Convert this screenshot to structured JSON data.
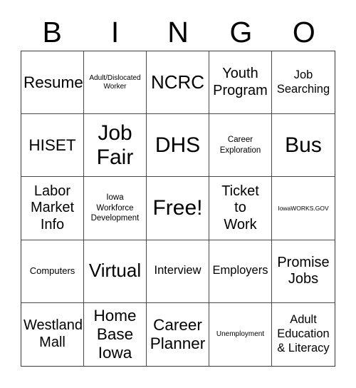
{
  "card": {
    "header_letters": [
      "B",
      "I",
      "N",
      "G",
      "O"
    ],
    "columns": 5,
    "rows": 5,
    "background_color": "#ffffff",
    "text_color": "#000000",
    "border_color": "#3a3a3a",
    "cells": [
      {
        "text": "Resume",
        "size": "fs-l"
      },
      {
        "text": "Adult/Dislocated\nWorker",
        "size": "fs-xs"
      },
      {
        "text": "NCRC",
        "size": "fs-xl"
      },
      {
        "text": "Youth\nProgram",
        "size": "fs-ml"
      },
      {
        "text": "Job\nSearching",
        "size": "fs-m"
      },
      {
        "text": "HISET",
        "size": "fs-l"
      },
      {
        "text": "Job\nFair",
        "size": "fs-xxl"
      },
      {
        "text": "DHS",
        "size": "fs-xxl"
      },
      {
        "text": "Career\nExploration",
        "size": "fs-s"
      },
      {
        "text": "Bus",
        "size": "fs-xxl"
      },
      {
        "text": "Labor\nMarket\nInfo",
        "size": "fs-ml"
      },
      {
        "text": "Iowa\nWorkforce\nDevelopment",
        "size": "fs-s"
      },
      {
        "text": "Free!",
        "size": "fs-xxl"
      },
      {
        "text": "Ticket\nto\nWork",
        "size": "fs-ml"
      },
      {
        "text": "IowaWORKS.GOV",
        "size": "fs-xxs"
      },
      {
        "text": "Computers",
        "size": "fs-sm"
      },
      {
        "text": "Virtual",
        "size": "fs-xl"
      },
      {
        "text": "Interview",
        "size": "fs-m"
      },
      {
        "text": "Employers",
        "size": "fs-m"
      },
      {
        "text": "Promise\nJobs",
        "size": "fs-ml"
      },
      {
        "text": "Westland\nMall",
        "size": "fs-ml"
      },
      {
        "text": "Home\nBase\nIowa",
        "size": "fs-l"
      },
      {
        "text": "Career\nPlanner",
        "size": "fs-l"
      },
      {
        "text": "Unemployment",
        "size": "fs-xs"
      },
      {
        "text": "Adult\nEducation\n& Literacy",
        "size": "fs-m"
      }
    ]
  }
}
